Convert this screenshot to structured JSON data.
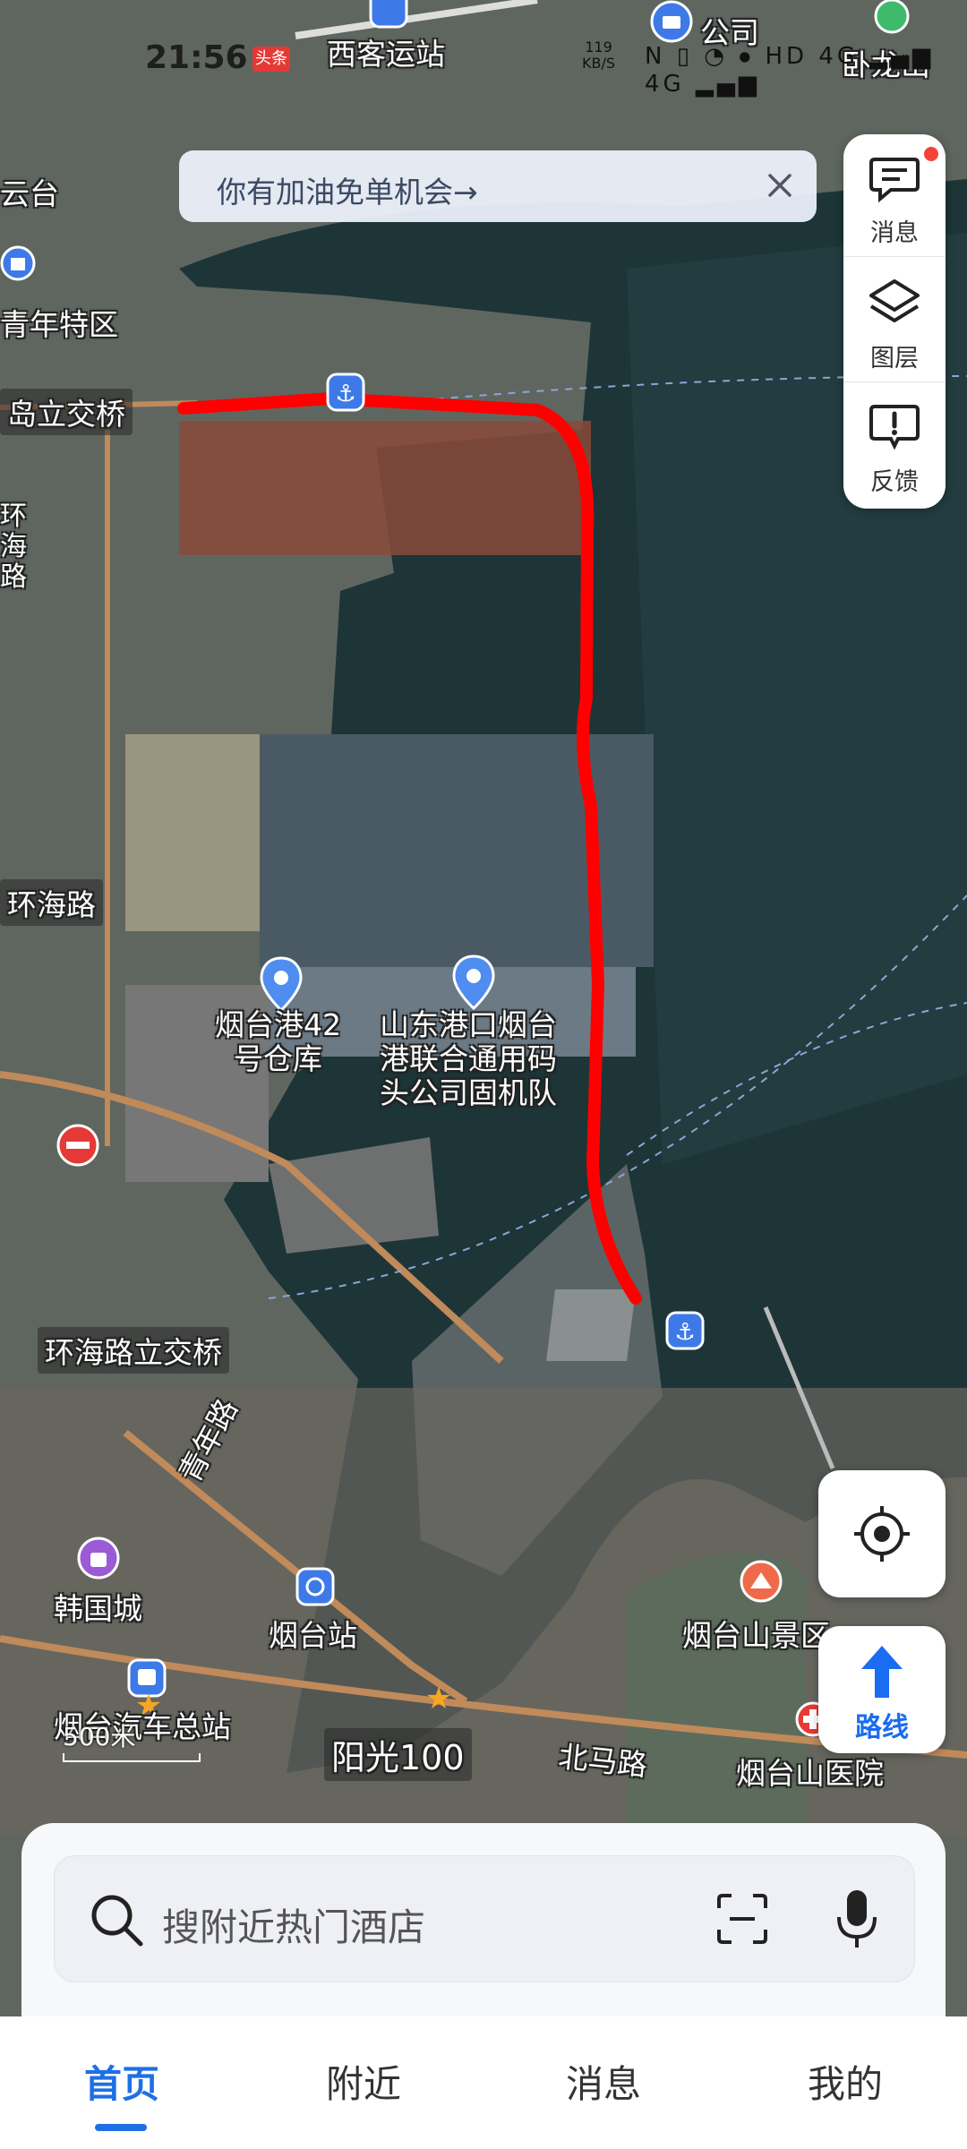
{
  "status_bar": {
    "time": "21:56",
    "news_badge": "头条",
    "speed_value": "119",
    "speed_unit": "KB/S",
    "indicators": "N ▯ ◔ ⦁ HD 4G ▂▄▆ 4G ▂▄▆"
  },
  "banner": {
    "text": "你有加油免单机会→",
    "close_icon": "close-icon"
  },
  "tools": [
    {
      "label": "消息",
      "icon": "message-icon"
    },
    {
      "label": "图层",
      "icon": "layers-icon"
    },
    {
      "label": "反馈",
      "icon": "feedback-icon"
    }
  ],
  "map_labels": {
    "bus_station_top": "西客运站",
    "company": "公司",
    "wolongshan": "卧龙山",
    "tai": "云台",
    "youth_zone": "青年特区",
    "overpass_top": "岛立交桥",
    "vertical_road": "环海路",
    "huanhai_road": "环海路",
    "warehouse": "烟台港42\n号仓库",
    "port_team": "山东港口烟台\n港联合通用码\n头公司固机队",
    "huanhai_overpass": "环海路立交桥",
    "qingnian_road": "青年路",
    "korea_city": "韩国城",
    "yantai_station": "烟台站",
    "yantaishan": "烟台山景区",
    "bus_terminal": "烟台汽车总站",
    "sunshine": "阳光100",
    "beima_road": "北马路",
    "hospital": "烟台山医院"
  },
  "scale": "500米",
  "controls": {
    "locate_icon": "locate-icon",
    "route_label": "路线"
  },
  "search": {
    "placeholder": "搜附近热门酒店"
  },
  "tabs": [
    {
      "label": "首页",
      "active": true
    },
    {
      "label": "附近",
      "active": false
    },
    {
      "label": "消息",
      "active": false
    },
    {
      "label": "我的",
      "active": false
    }
  ],
  "colors": {
    "accent": "#1f6fe5",
    "route_red": "#ff0000",
    "water": "#1f3a3d"
  }
}
